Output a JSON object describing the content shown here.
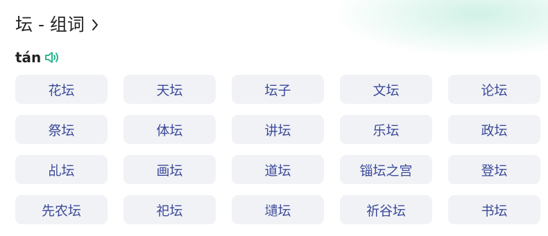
{
  "header": {
    "title": "坛 - 组词",
    "chevron_icon": "chevron-right-icon"
  },
  "pronunciation": {
    "pinyin": "tán",
    "sound_icon": "speaker-icon",
    "sound_color": "#28b68f"
  },
  "words": [
    "花坛",
    "天坛",
    "坛子",
    "文坛",
    "论坛",
    "祭坛",
    "体坛",
    "讲坛",
    "乐坛",
    "政坛",
    "乩坛",
    "画坛",
    "道坛",
    "锱坛之宫",
    "登坛",
    "先农坛",
    "祀坛",
    "壝坛",
    "祈谷坛",
    "书坛"
  ],
  "colors": {
    "word_text": "#3b4a9a",
    "chip_bg": "#f1f2f5"
  }
}
